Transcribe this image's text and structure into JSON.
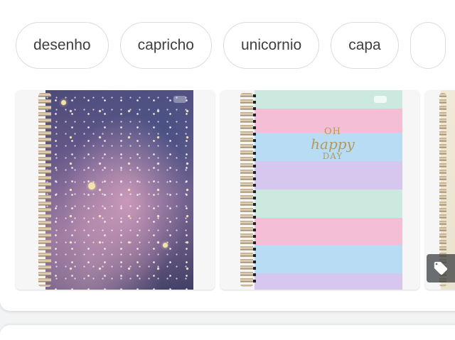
{
  "chips": [
    "desenho",
    "capricho",
    "unicornio",
    "capa",
    ""
  ],
  "pastel_cover": {
    "line1": "OH",
    "line2": "happy",
    "line3": "DAY"
  },
  "icons": [
    "price-tag-icon"
  ],
  "colors": {
    "chip_border": "#dadce0",
    "chip_text": "#3c4043",
    "tag_overlay": "#3c4043"
  }
}
